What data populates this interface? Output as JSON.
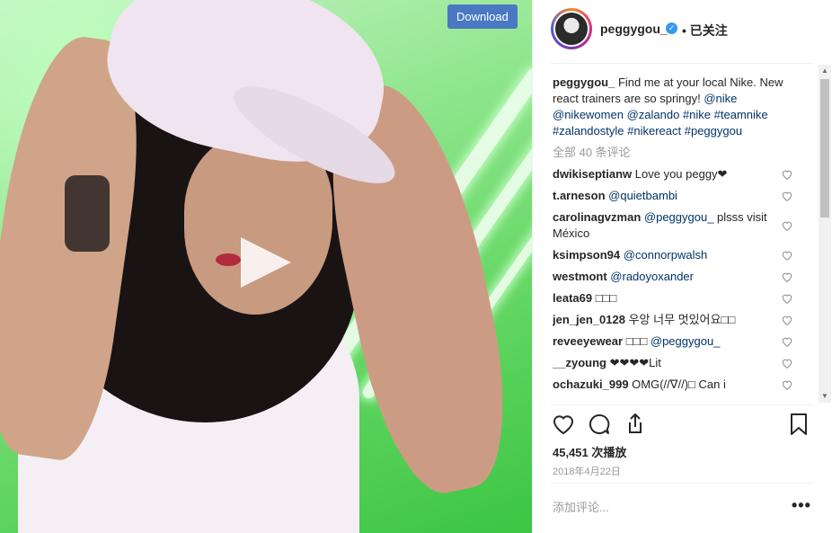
{
  "media": {
    "download_label": "Download",
    "play_icon": "play-icon"
  },
  "header": {
    "username": "peggygou_",
    "verified_icon": "verified-badge-icon",
    "verified_glyph": "✓",
    "follow_label": "• 已关注"
  },
  "caption": {
    "username": "peggygou_",
    "text": " Find me at your local Nike. New react trainers are so springy! ",
    "tags": [
      "@nike",
      "@nikewomen",
      "@zalando",
      "#nike",
      "#teamnike",
      "#zalandostyle",
      "#nikereact",
      "#peggygou"
    ]
  },
  "all_comments_label": "全部 40 条评论",
  "comments": [
    {
      "user": "dwikiseptianw",
      "text": "Love you peggy❤",
      "mention": ""
    },
    {
      "user": "t.arneson",
      "text": "",
      "mention": "@quietbambi"
    },
    {
      "user": "carolinagvzman",
      "text": "",
      "mention": "@peggygou_",
      "after": " plsss visit México"
    },
    {
      "user": "ksimpson94",
      "text": "",
      "mention": "@connorpwalsh"
    },
    {
      "user": "westmont",
      "text": "",
      "mention": "@radoyoxander"
    },
    {
      "user": "leata69",
      "text": "□□□",
      "mention": ""
    },
    {
      "user": "jen_jen_0128",
      "text": "우앙 너무 멋있어요□□",
      "mention": ""
    },
    {
      "user": "reveeyewear",
      "text": "□□□ ",
      "mention": "@peggygou_"
    },
    {
      "user": "__zyoung",
      "text": "❤❤❤❤Lit",
      "mention": ""
    },
    {
      "user": "ochazuki_999",
      "text": "OMG(//∇//)□ Can i",
      "mention": ""
    }
  ],
  "actions": {
    "like_icon": "heart-icon",
    "comment_icon": "comment-icon",
    "share_icon": "share-icon",
    "save_icon": "bookmark-icon"
  },
  "views": "45,451 次播放",
  "date": "2018年4月22日",
  "comment_input": {
    "placeholder": "添加评论..."
  },
  "more_label": "•••",
  "colors": {
    "download_bg": "#4a78c2",
    "tag": "#003569",
    "muted": "#999999",
    "verified": "#3897f0"
  }
}
